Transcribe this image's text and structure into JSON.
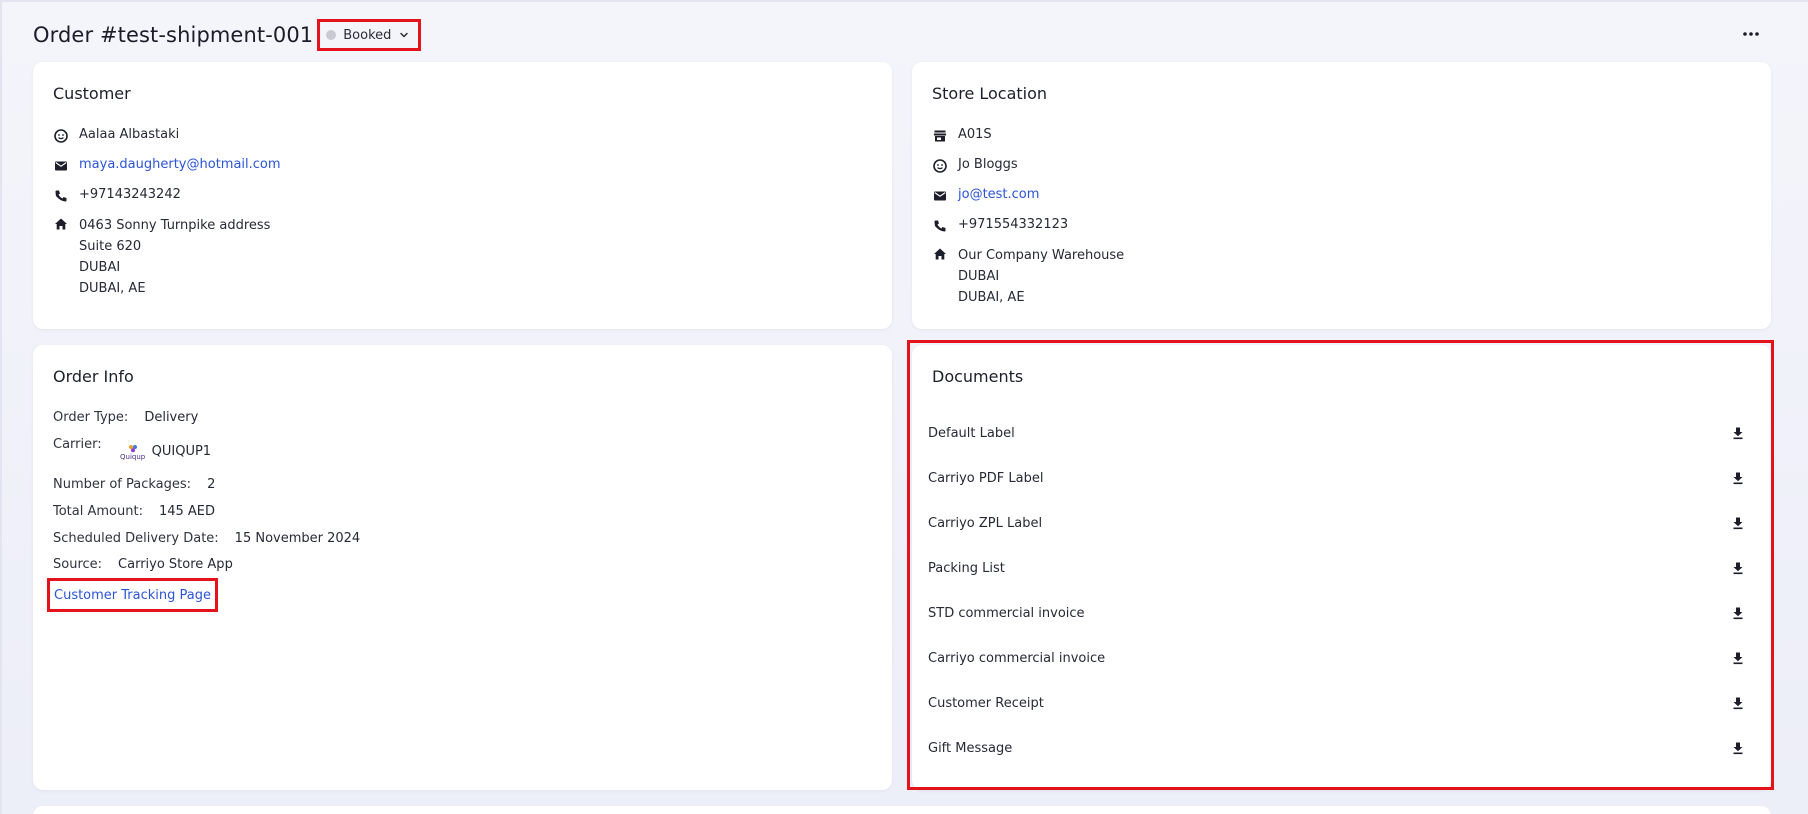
{
  "header": {
    "title": "Order #test-shipment-001",
    "status": "Booked"
  },
  "customer": {
    "title": "Customer",
    "name": "Aalaa Albastaki",
    "email": "maya.daugherty@hotmail.com",
    "phone": "+97143243242",
    "address": [
      "0463 Sonny Turnpike address",
      "Suite 620",
      "DUBAI",
      "DUBAI, AE"
    ]
  },
  "store": {
    "title": "Store Location",
    "code": "A01S",
    "contact": "Jo Bloggs",
    "email": "jo@test.com",
    "phone": "+971554332123",
    "address": [
      "Our Company Warehouse",
      "DUBAI",
      "DUBAI, AE"
    ]
  },
  "order_info": {
    "title": "Order Info",
    "order_type_label": "Order Type:",
    "order_type": "Delivery",
    "carrier_label": "Carrier:",
    "carrier_logo_text": "Quiqup",
    "carrier": "QUIQUP1",
    "packages_label": "Number of Packages:",
    "packages": "2",
    "total_label": "Total Amount:",
    "total": "145 AED",
    "scheduled_label": "Scheduled Delivery Date:",
    "scheduled": "15 November 2024",
    "source_label": "Source:",
    "source": "Carriyo Store App",
    "tracking_link": "Customer Tracking Page"
  },
  "documents": {
    "title": "Documents",
    "items": [
      "Default Label",
      "Carriyo PDF Label",
      "Carriyo ZPL Label",
      "Packing List",
      "STD commercial invoice",
      "Carriyo commercial invoice",
      "Customer Receipt",
      "Gift Message"
    ]
  },
  "colors": {
    "accent_link": "#2b54d6",
    "highlight": "#e3121b",
    "status_dot": "#c9cbd3"
  }
}
